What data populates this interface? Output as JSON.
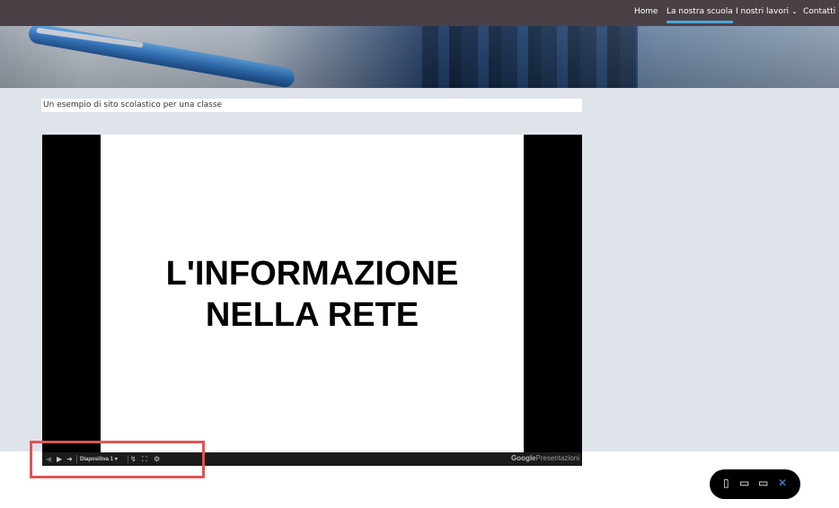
{
  "nav": {
    "items": [
      {
        "label": "Home"
      },
      {
        "label": "La nostra scuola",
        "active": true
      },
      {
        "label": "I nostri lavori",
        "has_dropdown": true
      },
      {
        "label": "Contatti"
      }
    ]
  },
  "page": {
    "subtitle": "Un esempio di sito scolastico per una classe"
  },
  "presentation": {
    "slide_title_line1": "L'INFORMAZIONE",
    "slide_title_line2": "NELLA RETE",
    "slide_selector": "Diapositiva 1",
    "brand_google": "Google",
    "brand_product": "Presentazioni"
  },
  "icons": {
    "prev": "prev-arrow-icon",
    "play": "play-icon",
    "next": "next-arrow-icon",
    "dropdown": "chevron-down-icon",
    "link": "link-icon",
    "fullscreen": "fullscreen-icon",
    "settings": "gear-icon",
    "mobile": "mobile-icon",
    "tablet": "tablet-icon",
    "desktop": "desktop-icon",
    "close": "close-icon"
  },
  "colors": {
    "nav_bg": "#4a4046",
    "nav_active_underline": "#4aa8d8",
    "page_bg": "#dfe3ea",
    "highlight": "#e05454",
    "close_icon": "#4a90e2"
  }
}
